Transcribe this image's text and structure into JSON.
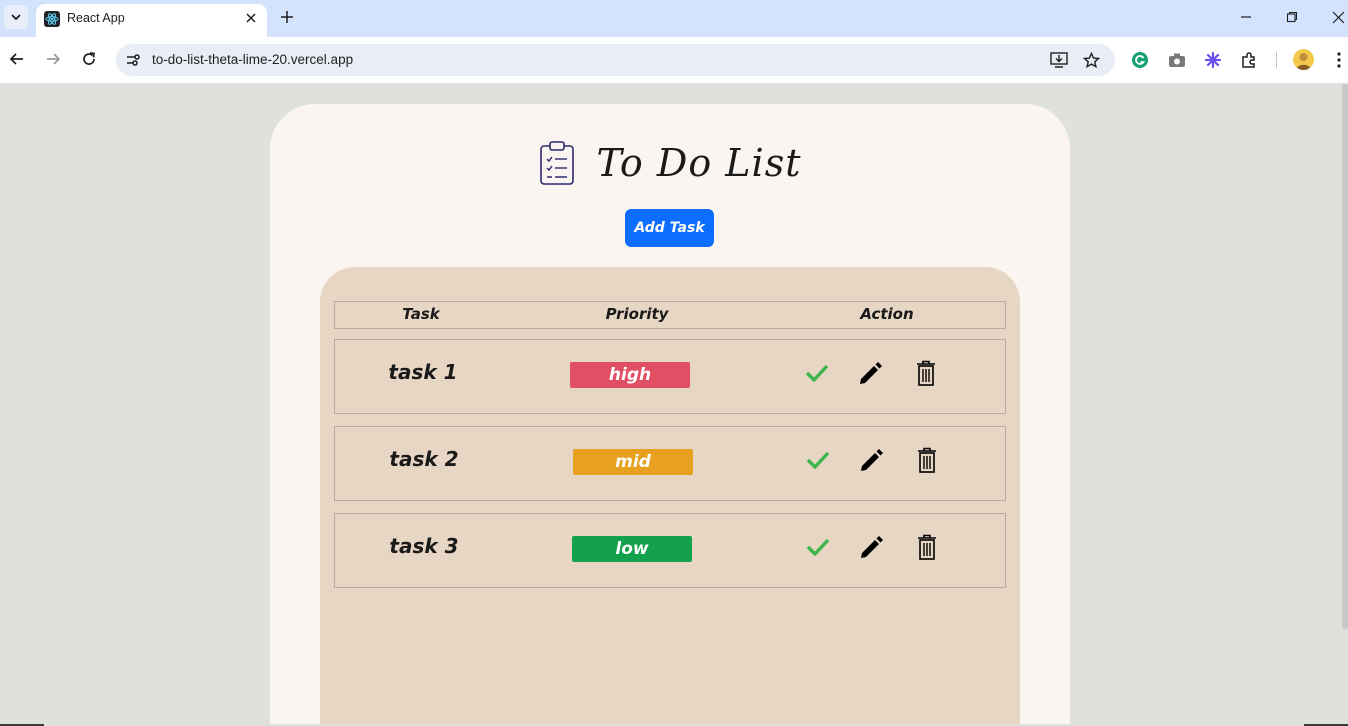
{
  "browser": {
    "tab_title": "React App",
    "url": "to-do-list-theta-lime-20.vercel.app"
  },
  "app": {
    "title": "To Do List",
    "add_button": "Add Task"
  },
  "table": {
    "headers": [
      "Task",
      "Priority",
      "Action"
    ],
    "rows": [
      {
        "task": "task 1",
        "priority": "high",
        "color": "#e04f64"
      },
      {
        "task": "task 2",
        "priority": "mid",
        "color": "#e8a020"
      },
      {
        "task": "task 3",
        "priority": "low",
        "color": "#13a24b"
      }
    ]
  },
  "colors": {
    "page_bg": "#dee1dc",
    "card_bg": "#faf5f0",
    "panel_bg": "#e8d6c4",
    "accent": "#0d6efd",
    "check": "#3cb54a"
  },
  "icons": {
    "title": "clipboard-icon",
    "actions": [
      "check-icon",
      "pencil-icon",
      "trash-icon"
    ]
  }
}
